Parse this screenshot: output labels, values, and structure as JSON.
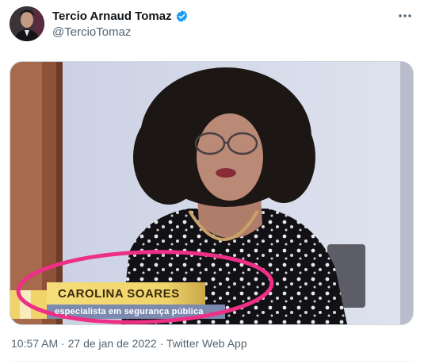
{
  "author": {
    "display_name": "Tercio Arnaud Tomaz",
    "handle": "@TercioTomaz",
    "verified": true
  },
  "more_icon": "more-horizontal-icon",
  "media": {
    "lower_third": {
      "name": "CAROLINA SOARES",
      "subtitle": "especialista em segurança pública"
    }
  },
  "meta": {
    "time": "10:57 AM",
    "separator": " · ",
    "date": "27 de jan de 2022",
    "source": "Twitter Web App"
  },
  "colors": {
    "verified_badge": "#1d9bf0",
    "highlight_circle": "#ee2f86",
    "lower_third_bar": "#f2d56a",
    "secondary_text": "#536471"
  }
}
